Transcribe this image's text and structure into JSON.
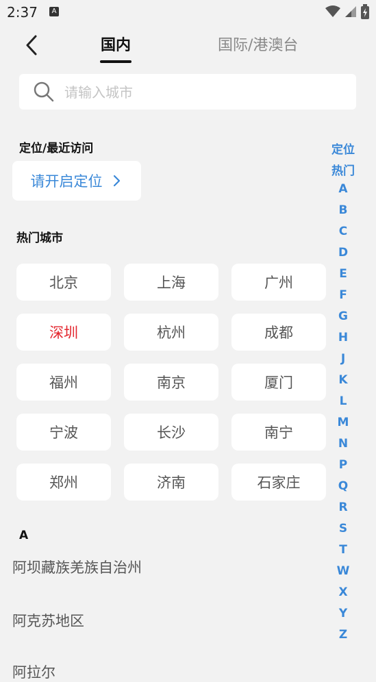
{
  "status": {
    "time": "2:37",
    "notif_icon": "A"
  },
  "tabs": [
    {
      "label": "国内"
    },
    {
      "label": "国际/港澳台"
    }
  ],
  "search": {
    "placeholder": "请输入城市"
  },
  "location": {
    "section_title": "定位/最近访问",
    "button_label": "请开启定位"
  },
  "hot": {
    "title": "热门城市",
    "cities": [
      {
        "name": "北京",
        "active": false
      },
      {
        "name": "上海",
        "active": false
      },
      {
        "name": "广州",
        "active": false
      },
      {
        "name": "深圳",
        "active": true
      },
      {
        "name": "杭州",
        "active": false
      },
      {
        "name": "成都",
        "active": false
      },
      {
        "name": "福州",
        "active": false
      },
      {
        "name": "南京",
        "active": false
      },
      {
        "name": "厦门",
        "active": false
      },
      {
        "name": "宁波",
        "active": false
      },
      {
        "name": "长沙",
        "active": false
      },
      {
        "name": "南宁",
        "active": false
      },
      {
        "name": "郑州",
        "active": false
      },
      {
        "name": "济南",
        "active": false
      },
      {
        "name": "石家庄",
        "active": false
      }
    ],
    "active_color": "#e3262e"
  },
  "list": {
    "letter": "A",
    "items": [
      "阿坝藏族羌族自治州",
      "阿克苏地区",
      "阿拉尔"
    ]
  },
  "index": [
    "定位",
    "热门",
    "A",
    "B",
    "C",
    "D",
    "E",
    "F",
    "G",
    "H",
    "J",
    "K",
    "L",
    "M",
    "N",
    "P",
    "Q",
    "R",
    "S",
    "T",
    "W",
    "X",
    "Y",
    "Z"
  ],
  "accent_color": "#3a88d8"
}
